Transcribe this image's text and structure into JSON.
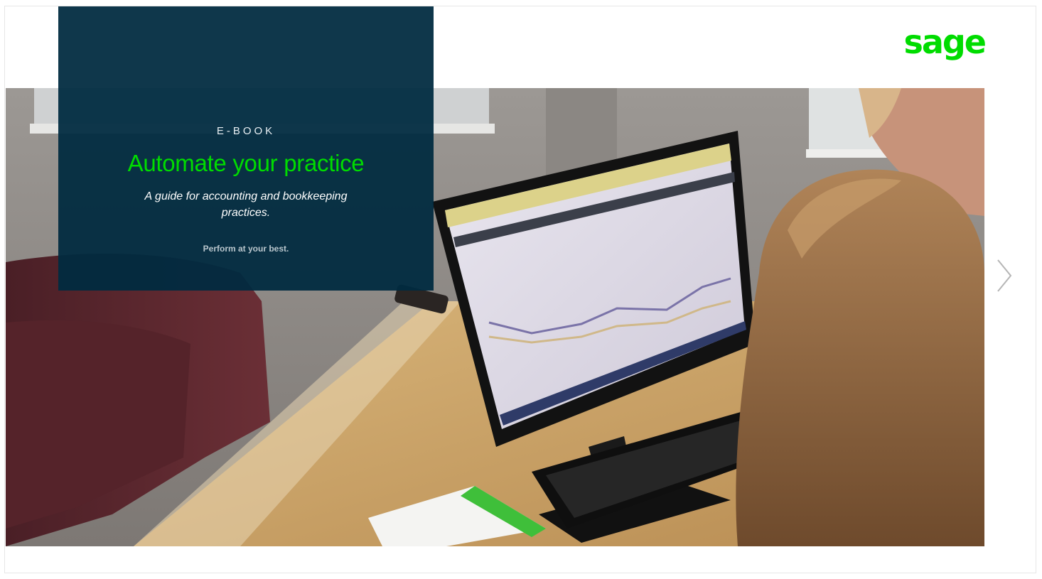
{
  "logo": {
    "text": "sage"
  },
  "cover": {
    "eyebrow": "E-BOOK",
    "title": "Automate your practice",
    "subtitle": "A guide for accounting and bookkeeping practices.",
    "tagline": "Perform at your best."
  },
  "icons": {
    "next": "chevron-right-icon"
  },
  "colors": {
    "brand_green": "#00dc00",
    "overlay_navy": "#002a40",
    "subtle_text": "#b9c6cd"
  }
}
